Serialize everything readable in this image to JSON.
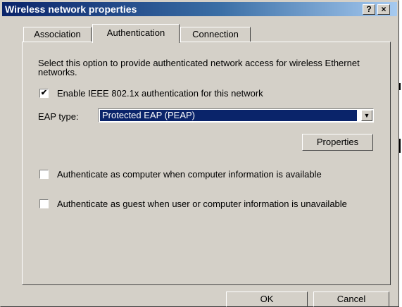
{
  "window": {
    "title": "Wireless network properties",
    "help_button": "?",
    "close_button": "×"
  },
  "tabs": [
    {
      "label": "Association",
      "active": false
    },
    {
      "label": "Authentication",
      "active": true
    },
    {
      "label": "Connection",
      "active": false
    }
  ],
  "auth": {
    "description": "Select this option to provide authenticated network access for wireless Ethernet networks.",
    "enable_8021x": {
      "label": "Enable IEEE 802.1x authentication for this network",
      "checked": true
    },
    "eap_type_label": "EAP type:",
    "eap_type_value": "Protected EAP (PEAP)",
    "properties_button": "Properties",
    "auth_as_computer": {
      "label": "Authenticate as computer when computer information is available",
      "checked": false
    },
    "auth_as_guest": {
      "label": "Authenticate as guest when user or computer information is unavailable",
      "checked": false
    }
  },
  "footer": {
    "ok_button": "OK",
    "cancel_button": "Cancel"
  },
  "colors": {
    "dialog_bg": "#d4d0c8",
    "titlebar_start": "#0a246a",
    "selection": "#0a246a"
  },
  "icons": {
    "check": "checkmark-icon",
    "dropdown": "chevron-down-icon"
  }
}
